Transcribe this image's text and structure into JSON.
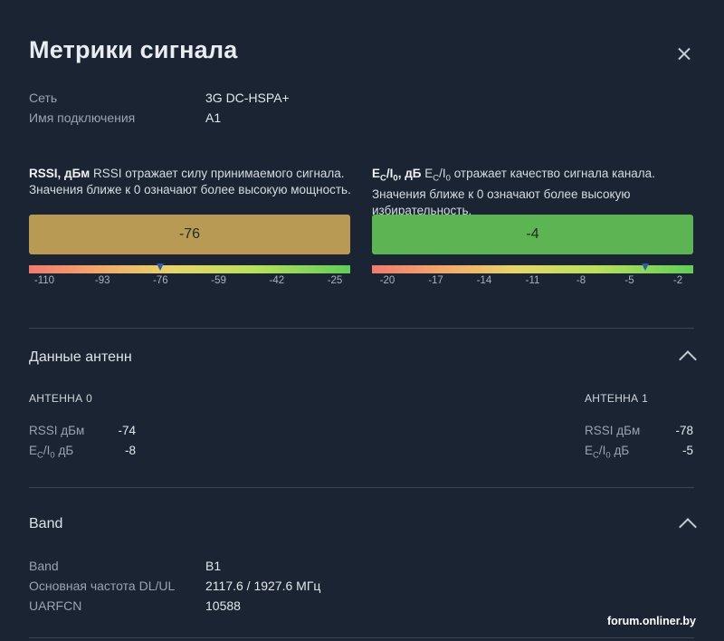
{
  "dialog": {
    "title": "Метрики сигнала"
  },
  "info": [
    {
      "label": "Сеть",
      "value": "3G DC-HSPA+"
    },
    {
      "label": "Имя подключения",
      "value": "A1"
    }
  ],
  "rssi": {
    "title": "RSSI, дБм",
    "description": "RSSI отражает силу принимаемого сигнала. Значения ближе к 0 означают более высокую мощность.",
    "value": "-76",
    "value_num": -76,
    "bar_color": "#b99a55",
    "scale_min": -110,
    "scale_max": -25,
    "ticks": [
      "-110",
      "-93",
      "-76",
      "-59",
      "-42",
      "-25"
    ]
  },
  "ecio": {
    "title_main": "E",
    "title_sub1": "C",
    "title_slash": "/I",
    "title_sub2": "0",
    "title_unit": ", дБ",
    "desc_main": "E",
    "desc_sub1": "C",
    "desc_slash": "/I",
    "desc_sub2": "0",
    "description": " отражает качество сигнала канала. Значения ближе к 0 означают более высокую избирательность.",
    "value": "-4",
    "value_num": -4,
    "bar_color": "#5cb552",
    "scale_min": -20,
    "scale_max": -2,
    "ticks": [
      "-20",
      "-17",
      "-14",
      "-11",
      "-8",
      "-5",
      "-2"
    ]
  },
  "antenna_section": {
    "title": "Данные антенн",
    "antennas": [
      {
        "name": "АНТЕННА 0",
        "rssi_label": "RSSI дБм",
        "rssi": "-74",
        "ecio_main": "E",
        "ecio_sub1": "C",
        "ecio_slash": "/I",
        "ecio_sub2": "0",
        "ecio_unit": " дБ",
        "ecio": "-8"
      },
      {
        "name": "АНТЕННА 1",
        "rssi_label": "RSSI дБм",
        "rssi": "-78",
        "ecio_main": "E",
        "ecio_sub1": "C",
        "ecio_slash": "/I",
        "ecio_sub2": "0",
        "ecio_unit": " дБ",
        "ecio": "-5"
      }
    ]
  },
  "band_section": {
    "title": "Band",
    "rows": [
      {
        "label": "Band",
        "value": "B1"
      },
      {
        "label": "Основная частота DL/UL",
        "value": "2117.6 / 1927.6 МГц"
      },
      {
        "label": "UARFCN",
        "value": "10588"
      }
    ]
  },
  "watermark": "forum.onliner.by"
}
